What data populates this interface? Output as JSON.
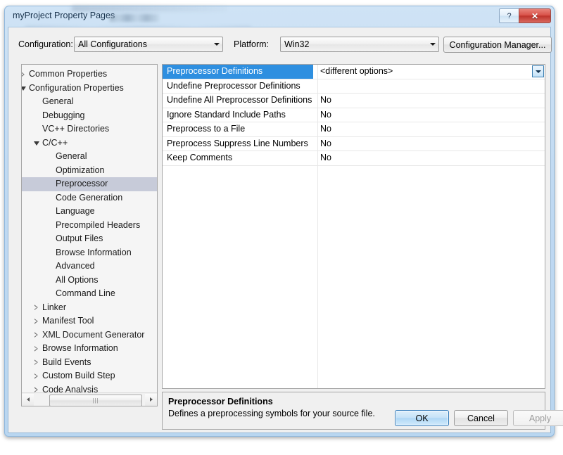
{
  "window": {
    "title": "myProject Property Pages",
    "help_button": "?",
    "close_button": "✕"
  },
  "toolbar": {
    "configuration_label": "Configuration:",
    "configuration_value": "All Configurations",
    "platform_label": "Platform:",
    "platform_value": "Win32",
    "configuration_manager_label": "Configuration Manager..."
  },
  "tree": {
    "items": [
      {
        "label": "Common Properties",
        "indent": 0,
        "state": "collapsed",
        "selected": false
      },
      {
        "label": "Configuration Properties",
        "indent": 0,
        "state": "expanded",
        "selected": false
      },
      {
        "label": "General",
        "indent": 1,
        "state": "leaf",
        "selected": false
      },
      {
        "label": "Debugging",
        "indent": 1,
        "state": "leaf",
        "selected": false
      },
      {
        "label": "VC++ Directories",
        "indent": 1,
        "state": "leaf",
        "selected": false
      },
      {
        "label": "C/C++",
        "indent": 1,
        "state": "expanded",
        "selected": false
      },
      {
        "label": "General",
        "indent": 2,
        "state": "leaf",
        "selected": false
      },
      {
        "label": "Optimization",
        "indent": 2,
        "state": "leaf",
        "selected": false
      },
      {
        "label": "Preprocessor",
        "indent": 2,
        "state": "leaf",
        "selected": true
      },
      {
        "label": "Code Generation",
        "indent": 2,
        "state": "leaf",
        "selected": false
      },
      {
        "label": "Language",
        "indent": 2,
        "state": "leaf",
        "selected": false
      },
      {
        "label": "Precompiled Headers",
        "indent": 2,
        "state": "leaf",
        "selected": false
      },
      {
        "label": "Output Files",
        "indent": 2,
        "state": "leaf",
        "selected": false
      },
      {
        "label": "Browse Information",
        "indent": 2,
        "state": "leaf",
        "selected": false
      },
      {
        "label": "Advanced",
        "indent": 2,
        "state": "leaf",
        "selected": false
      },
      {
        "label": "All Options",
        "indent": 2,
        "state": "leaf",
        "selected": false
      },
      {
        "label": "Command Line",
        "indent": 2,
        "state": "leaf",
        "selected": false
      },
      {
        "label": "Linker",
        "indent": 1,
        "state": "collapsed",
        "selected": false
      },
      {
        "label": "Manifest Tool",
        "indent": 1,
        "state": "collapsed",
        "selected": false
      },
      {
        "label": "XML Document Generator",
        "indent": 1,
        "state": "collapsed",
        "selected": false
      },
      {
        "label": "Browse Information",
        "indent": 1,
        "state": "collapsed",
        "selected": false
      },
      {
        "label": "Build Events",
        "indent": 1,
        "state": "collapsed",
        "selected": false
      },
      {
        "label": "Custom Build Step",
        "indent": 1,
        "state": "collapsed",
        "selected": false
      },
      {
        "label": "Code Analysis",
        "indent": 1,
        "state": "collapsed",
        "selected": false
      }
    ],
    "hscroll_grip": "|||"
  },
  "property_grid": {
    "rows": [
      {
        "name": "Preprocessor Definitions",
        "value": "<different options>",
        "selected": true,
        "has_dropdown": true
      },
      {
        "name": "Undefine Preprocessor Definitions",
        "value": "",
        "selected": false,
        "has_dropdown": false
      },
      {
        "name": "Undefine All Preprocessor Definitions",
        "value": "No",
        "selected": false,
        "has_dropdown": false
      },
      {
        "name": "Ignore Standard Include Paths",
        "value": "No",
        "selected": false,
        "has_dropdown": false
      },
      {
        "name": "Preprocess to a File",
        "value": "No",
        "selected": false,
        "has_dropdown": false
      },
      {
        "name": "Preprocess Suppress Line Numbers",
        "value": "No",
        "selected": false,
        "has_dropdown": false
      },
      {
        "name": "Keep Comments",
        "value": "No",
        "selected": false,
        "has_dropdown": false
      }
    ]
  },
  "description": {
    "title": "Preprocessor Definitions",
    "body": "Defines a preprocessing symbols for your source file."
  },
  "footer": {
    "ok_label": "OK",
    "cancel_label": "Cancel",
    "apply_label": "Apply",
    "apply_enabled": false
  },
  "colors": {
    "selection_blue": "#2e8fe0",
    "tree_selection_gray": "#c7cbd9",
    "dialog_bg": "#f0f0f0",
    "frame_blue": "#b9d6f0",
    "close_red": "#bf342c"
  }
}
